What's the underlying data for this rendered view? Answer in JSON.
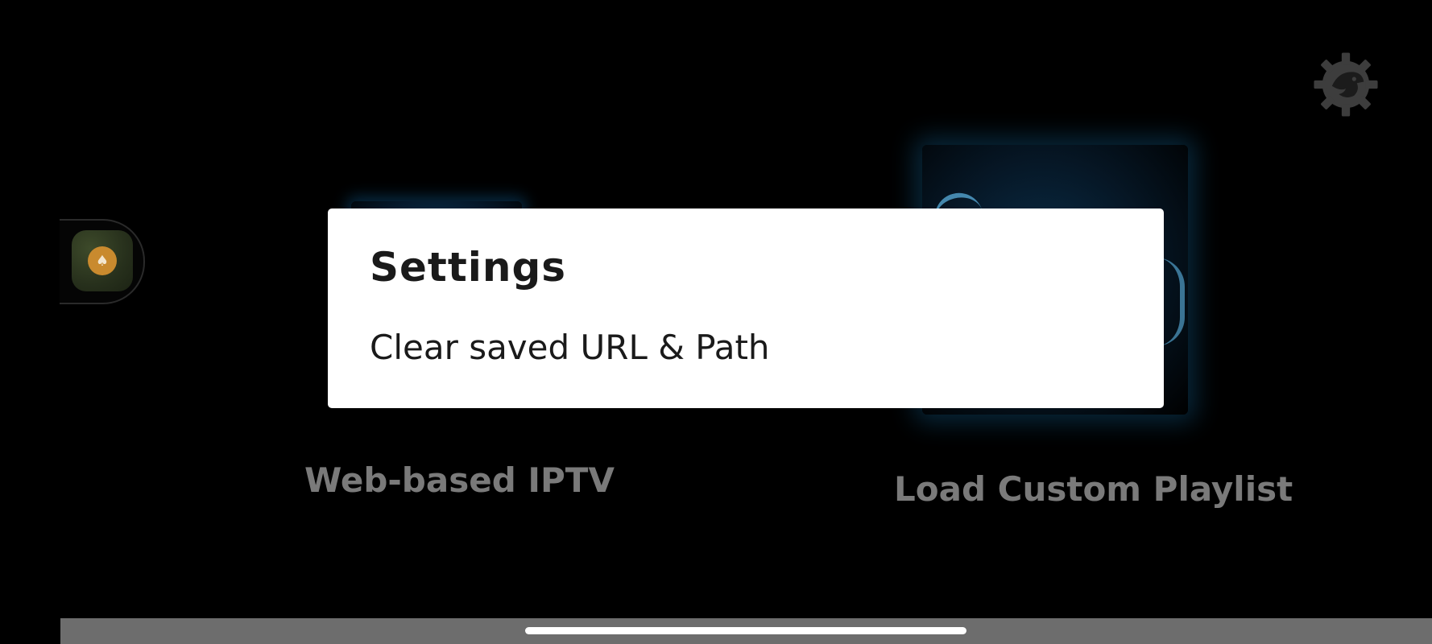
{
  "background": {
    "tiles": [
      {
        "label": "Web-based IPTV"
      },
      {
        "label": "Load Custom Playlist"
      }
    ],
    "settings_icon": "gear-icon",
    "assistive_icon": "accessibility-icon"
  },
  "dialog": {
    "title": "Settings",
    "items": [
      {
        "label": "Clear saved URL & Path"
      }
    ]
  },
  "colors": {
    "background": "#000000",
    "dialog": "#ffffff",
    "dim_label": "#7a7a7a",
    "glow": "#5fb8e8",
    "assistive_dot": "#c98a2e"
  }
}
